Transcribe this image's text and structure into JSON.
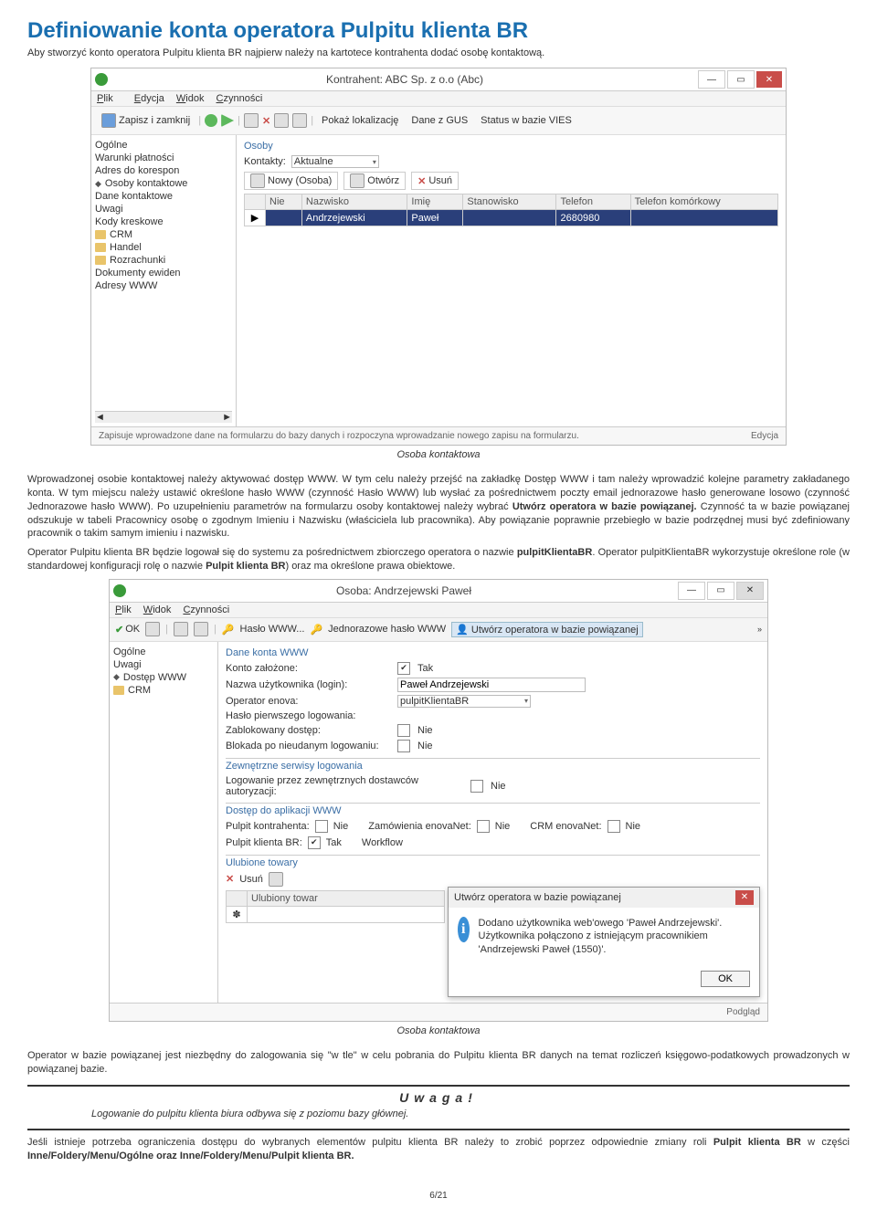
{
  "heading": "Definiowanie konta operatora Pulpitu klienta BR",
  "intro": "Aby stworzyć konto operatora Pulpitu klienta BR najpierw należy na kartotece kontrahenta dodać osobę kontaktową.",
  "win1": {
    "title": "Kontrahent: ABC Sp. z o.o (Abc)",
    "menu": {
      "plik": "Plik",
      "edycja": "Edycja",
      "widok": "Widok",
      "czynnosci": "Czynności"
    },
    "toolbar": {
      "zapisz": "Zapisz i zamknij",
      "lokalizacja": "Pokaż lokalizację",
      "gus": "Dane z GUS",
      "vies": "Status w bazie VIES"
    },
    "sidebar": {
      "ogolne": "Ogólne",
      "warunki": "Warunki płatności",
      "adres": "Adres do korespon",
      "osoby": "Osoby kontaktowe",
      "dane": "Dane kontaktowe",
      "uwagi": "Uwagi",
      "kody": "Kody kreskowe",
      "crm": "CRM",
      "handel": "Handel",
      "rozrachunki": "Rozrachunki",
      "dokumenty": "Dokumenty ewiden",
      "adresy": "Adresy WWW"
    },
    "osoby_label": "Osoby",
    "kontakty_label": "Kontakty:",
    "kontakty_value": "Aktualne",
    "gridbuttons": {
      "nowy": "Nowy (Osoba)",
      "otworz": "Otwórz",
      "usun": "Usuń"
    },
    "columns": {
      "nie": "Nie",
      "nazwisko": "Nazwisko",
      "imie": "Imię",
      "stanowisko": "Stanowisko",
      "telefon": "Telefon",
      "komorkowy": "Telefon komórkowy"
    },
    "row": {
      "nazwisko": "Andrzejewski",
      "imie": "Paweł",
      "telefon": "2680980"
    },
    "status": "Zapisuje wprowadzone dane na formularzu do bazy danych i rozpoczyna wprowadzanie nowego zapisu na formularzu.",
    "mode": "Edycja"
  },
  "caption1": "Osoba kontaktowa",
  "para1a": "Wprowadzonej osobie kontaktowej należy aktywować dostęp WWW. W tym celu należy przejść na zakładkę Dostęp WWW i tam należy wprowadzić kolejne parametry zakładanego konta. W tym miejscu należy ustawić określone hasło WWW (czynność Hasło WWW) lub wysłać za pośrednictwem poczty email jednorazowe hasło generowane losowo (czynność Jednorazowe hasło WWW). Po uzupełnieniu parametrów na formularzu osoby kontaktowej należy wybrać ",
  "para1b": "Utwórz operatora w bazie powiązanej.",
  "para1c": " Czynność ta w bazie powiązanej odszukuje w tabeli Pracownicy osobę o zgodnym Imieniu i Nazwisku (właściciela lub pracownika). Aby powiązanie poprawnie przebiegło w bazie podrzędnej musi być zdefiniowany pracownik o takim samym imieniu i nazwisku.",
  "para2a": "Operator Pulpitu klienta BR będzie logował się do systemu za pośrednictwem zbiorczego operatora o nazwie ",
  "para2b": "pulpitKlientaBR",
  "para2c": ". Operator pulpitKlientaBR wykorzystuje określone role (w standardowej konfiguracji rolę o nazwie ",
  "para2d": "Pulpit klienta BR",
  "para2e": ") oraz ma określone prawa obiektowe.",
  "win2": {
    "title": "Osoba: Andrzejewski Paweł",
    "menu": {
      "plik": "Plik",
      "widok": "Widok",
      "czynnosci": "Czynności"
    },
    "toolbar": {
      "ok": "OK",
      "haslo": "Hasło WWW...",
      "jednorazowe": "Jednorazowe hasło WWW",
      "utworz": "Utwórz operatora w bazie powiązanej"
    },
    "sidebar": {
      "ogolne": "Ogólne",
      "uwagi": "Uwagi",
      "dostep": "Dostęp WWW",
      "crm": "CRM"
    },
    "section_dane": "Dane konta WWW",
    "fields": {
      "konto_l": "Konto założone:",
      "konto_v": "Tak",
      "login_l": "Nazwa użytkownika (login):",
      "login_v": "Paweł Andrzejewski",
      "operator_l": "Operator enova:",
      "operator_v": "pulpitKlientaBR",
      "haslo_l": "Hasło pierwszego logowania:",
      "zablok_l": "Zablokowany dostęp:",
      "zablok_v": "Nie",
      "blokada_l": "Blokada po nieudanym logowaniu:",
      "blokada_v": "Nie"
    },
    "section_zewn": "Zewnętrzne serwisy logowania",
    "zewn_l": "Logowanie przez zewnętrznych dostawców autoryzacji:",
    "zewn_v": "Nie",
    "section_dostep": "Dostęp do aplikacji WWW",
    "apps": {
      "pk_l": "Pulpit kontrahenta:",
      "pk_v": "Nie",
      "zam_l": "Zamówienia enovaNet:",
      "zam_v": "Nie",
      "crm_l": "CRM enovaNet:",
      "crm_v": "Nie",
      "pkb_l": "Pulpit klienta BR:",
      "pkb_v": "Tak",
      "wf_l": "Workflow"
    },
    "section_fav": "Ulubione towary",
    "fav_usun": "Usuń",
    "fav_col": "Ulubiony towar",
    "mode": "Podgląd"
  },
  "dialog": {
    "title": "Utwórz operatora w bazie powiązanej",
    "body": "Dodano użytkownika web'owego 'Paweł Andrzejewski'. Użytkownika połączono z istniejącym pracownikiem 'Andrzejewski Paweł (1550)'.",
    "ok": "OK"
  },
  "caption2": "Osoba kontaktowa",
  "para3": "Operator w bazie powiązanej jest niezbędny do zalogowania się \"w tle\" w celu pobrania do Pulpitu klienta BR danych na temat rozliczeń księgowo-podatkowych prowadzonych w powiązanej bazie.",
  "alert_heading": "Uwaga!",
  "alert_body": "Logowanie do pulpitu klienta biura odbywa się z poziomu bazy głównej.",
  "para4a": "Jeśli istnieje potrzeba ograniczenia dostępu do wybranych elementów pulpitu klienta BR należy to zrobić poprzez odpowiednie zmiany roli ",
  "para4b": "Pulpit klienta BR",
  "para4c": " w części ",
  "para4d": "Inne/Foldery/Menu/Ogólne oraz Inne/Foldery/Menu/Pulpit klienta BR.",
  "page": "6/21"
}
